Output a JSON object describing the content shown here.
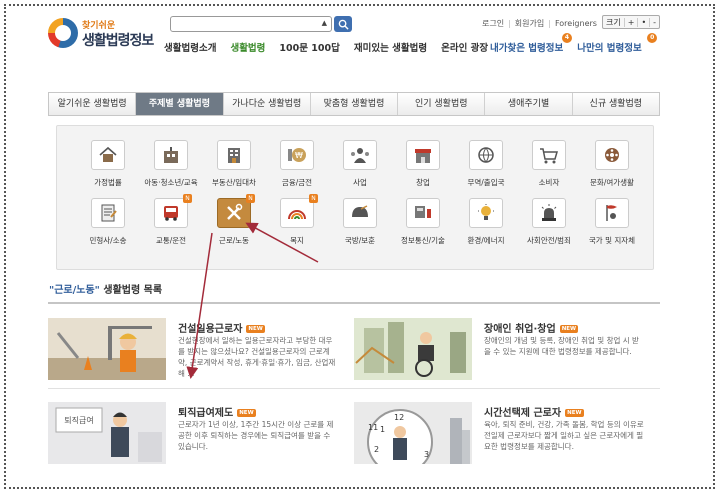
{
  "header": {
    "logo_small": "찾기쉬운",
    "logo_big": "생활법령정보",
    "search_placeholder": "",
    "util": [
      "로그인",
      "회원가입",
      "Foreigners"
    ],
    "fontsize": {
      "label": "크기",
      "plus": "+",
      "minus": "-",
      "reset": "•"
    }
  },
  "nav": {
    "items": [
      "생활법령소개",
      "생활법령",
      "100문 100답",
      "재미있는 생활법령",
      "온라인 광장"
    ],
    "active": "생활법령",
    "my": [
      {
        "label": "내가찾은 법령정보",
        "badge": "4"
      },
      {
        "label": "나만의 법령정보",
        "badge": "0"
      }
    ]
  },
  "tabs": [
    "알기쉬운 생활법령",
    "주제별 생활법령",
    "가나다순 생활법령",
    "맞춤형 생활법령",
    "인기 생활법령",
    "생애주기별",
    "신규 생활법령"
  ],
  "active_tab": "주제별 생활법령",
  "topics": [
    {
      "label": "가정법률",
      "icon": "house-icon"
    },
    {
      "label": "아동·청소년/교육",
      "icon": "school-icon"
    },
    {
      "label": "부동산/임대차",
      "icon": "building-icon"
    },
    {
      "label": "금융/금전",
      "icon": "coin-icon"
    },
    {
      "label": "사업",
      "icon": "people-icon"
    },
    {
      "label": "창업",
      "icon": "shop-icon"
    },
    {
      "label": "무역/출입국",
      "icon": "globe-icon"
    },
    {
      "label": "소비자",
      "icon": "cart-icon"
    },
    {
      "label": "문화/여가생활",
      "icon": "film-icon"
    },
    {
      "label": "민형사/소송",
      "icon": "document-icon"
    },
    {
      "label": "교통/운전",
      "icon": "bus-icon",
      "badge": "N"
    },
    {
      "label": "근로/노동",
      "icon": "tools-icon",
      "badge": "N",
      "selected": true
    },
    {
      "label": "복지",
      "icon": "rainbow-icon",
      "badge": "N"
    },
    {
      "label": "국방/보훈",
      "icon": "helmet-icon"
    },
    {
      "label": "정보통신/기술",
      "icon": "computer-icon"
    },
    {
      "label": "환경/에너지",
      "icon": "bulb-icon"
    },
    {
      "label": "사회안전/범죄",
      "icon": "siren-icon"
    },
    {
      "label": "국가 및 지자체",
      "icon": "flag-icon"
    }
  ],
  "list": {
    "quote_open": "\"",
    "topic": "근로/노동",
    "quote_close": "\"",
    "suffix": " 생활법령 목록",
    "items": [
      {
        "title": "건설일용근로자",
        "new": "NEW",
        "desc": "건설현장에서 일하는 일용근로자라고 부당한 대우를 받지는 않으셨나요? 건설일용근로자의 근로계약, 근로계약서 작성, 휴게·휴일·휴가, 임금, 산업재해 ..."
      },
      {
        "title": "장애인 취업·창업",
        "new": "NEW",
        "desc": "장애인의 개념 및 등록, 장애인 취업 및 창업 시 받을 수 있는 지원에 대한 법령정보를 제공합니다."
      },
      {
        "title": "퇴직급여제도",
        "new": "NEW",
        "desc": "근로자가 1년 이상, 1주간 15시간 이상 근로를 제공한 이후 퇴직하는 경우에는 퇴직급여를 받을 수 있습니다."
      },
      {
        "title": "시간선택제 근로자",
        "new": "NEW",
        "desc": "육아, 퇴직 준비, 건강, 가족 돌봄, 학업 등의 이유로 전일제 근로자보다 짧게 일하고 싶은 근로자에게 필요한 법령정보를 제공합니다."
      }
    ],
    "thumb_text": {
      "retire": "퇴직급여"
    }
  },
  "colors": {
    "accent": "#3f6fb0",
    "active_nav": "#3a8a2a",
    "badge": "#e9801f",
    "arrow": "#a32b3a"
  }
}
